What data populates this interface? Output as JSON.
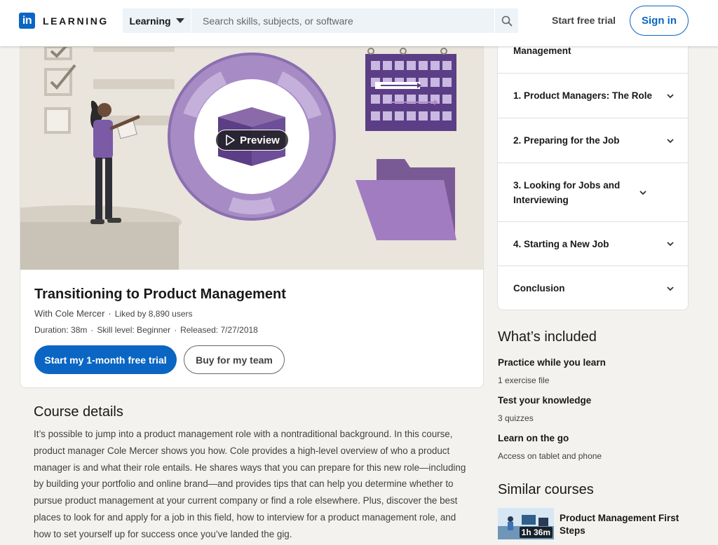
{
  "header": {
    "logo_in": "in",
    "logo_text": "LEARNING",
    "search_category": "Learning",
    "search_placeholder": "Search skills, subjects, or software",
    "start_free_trial": "Start free trial",
    "sign_in": "Sign in"
  },
  "course": {
    "preview_label": "Preview",
    "title": "Transitioning to Product Management",
    "instructor": "With Cole Mercer",
    "likes": "Liked by 8,890 users",
    "duration": "Duration: 38m",
    "skill_level": "Skill level: Beginner",
    "released": "Released: 7/27/2018",
    "primary_cta": "Start my 1-month free trial",
    "secondary_cta": "Buy for my team"
  },
  "details": {
    "heading": "Course details",
    "body": "It’s possible to jump into a product management role with a nontraditional background. In this course, product manager Cole Mercer shows you how. Cole provides a high-level overview of who a product manager is and what their role entails. He shares ways that you can prepare for this new role—including by building your portfolio and online brand—and provides tips that can help you determine whether to pursue product management at your current company or find a role elsewhere. Plus, discover the best places to look for and apply for a job in this field, how to interview for a product management role, and how to set yourself up for success once you’ve landed the gig."
  },
  "toc": {
    "partial_label": "Management",
    "items": [
      {
        "label": "1. Product Managers: The Role"
      },
      {
        "label": "2. Preparing for the Job"
      },
      {
        "label": "3. Looking for Jobs and Interviewing"
      },
      {
        "label": "4. Starting a New Job"
      },
      {
        "label": "Conclusion"
      }
    ]
  },
  "whats_included": {
    "heading": "What’s included",
    "items": [
      {
        "title": "Practice while you learn",
        "sub": "1 exercise file"
      },
      {
        "title": "Test your knowledge",
        "sub": "3 quizzes"
      },
      {
        "title": "Learn on the go",
        "sub": "Access on tablet and phone"
      }
    ]
  },
  "similar": {
    "heading": "Similar courses",
    "items": [
      {
        "title": "Product Management First Steps",
        "duration": "1h 36m"
      }
    ]
  },
  "colors": {
    "brand": "#0a66c2",
    "accent_purple": "#7b5ba6"
  }
}
